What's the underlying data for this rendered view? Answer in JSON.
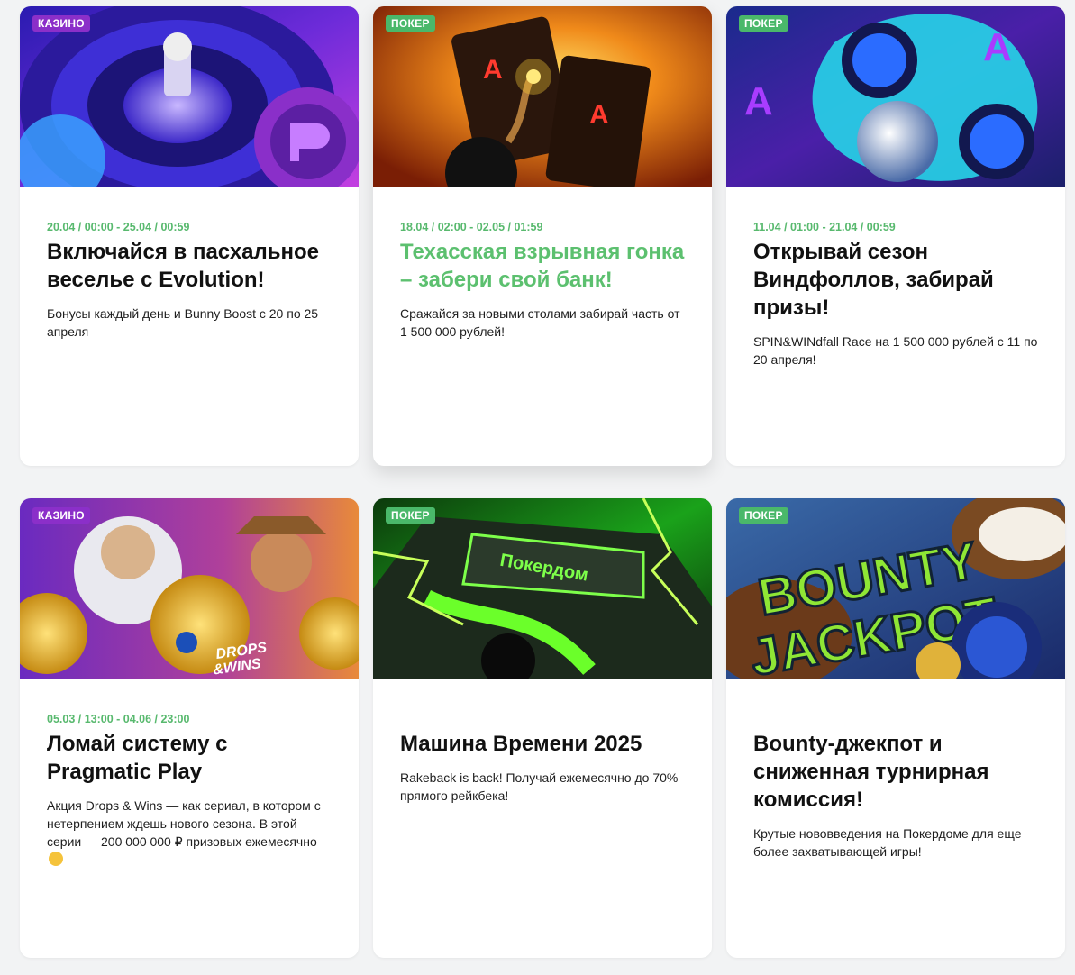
{
  "cards": [
    {
      "badge": "КАЗИНО",
      "date": "20.04 / 00:00 - 25.04 / 00:59",
      "title": "Включайся в пасхальное веселье с Evolution!",
      "description": "Бонусы каждый день и Bunny Boost с 20 по 25 апреля",
      "banner_icon": "roulette-wheel-icon"
    },
    {
      "badge": "ПОКЕР",
      "date": "18.04 / 02:00 - 02.05 / 01:59",
      "title": "Техасская взрывная гонка – забери свой банк!",
      "description": "Сражайся за новыми столами забирай часть от 1 500 000 рублей!",
      "banner_icon": "bomb-cards-icon"
    },
    {
      "badge": "ПОКЕР",
      "date": "11.04 / 01:00 - 21.04 / 00:59",
      "title": "Открывай сезон Виндфоллов, забирай призы!",
      "description": "SPIN&WINdfall Race на 1 500 000 рублей с 11 по 20 апреля!",
      "banner_icon": "fidget-spinner-icon"
    },
    {
      "badge": "КАЗИНО",
      "date": "05.03 / 13:00 - 04.06 / 23:00",
      "title": "Ломай систему с Pragmatic Play",
      "description": "Акция Drops & Wins — как сериал, в котором с нетерпением ждешь нового сезона. В этой серии — 200 000 000 ₽ призовых ежемесячно",
      "banner_icon": "drops-wins-icon",
      "banner_text": [
        "DROPS",
        "&WINS"
      ]
    },
    {
      "badge": "ПОКЕР",
      "date": "",
      "title": "Машина Времени 2025",
      "description": "Rakeback is back! Получай ежемесячно до 70% прямого рейкбека!",
      "banner_icon": "time-machine-car-icon",
      "banner_text": [
        "Покердом"
      ]
    },
    {
      "badge": "ПОКЕР",
      "date": "",
      "title": "Bounty-джекпот и сниженная турнирная комиссия!",
      "description": "Крутые нововведения на Покердоме для еще более захватывающей игры!",
      "banner_icon": "bounty-jackpot-icon",
      "banner_text": [
        "BOUNTY",
        "JACKPOT"
      ]
    }
  ],
  "colors": {
    "casino_badge": "#8b2fc9",
    "poker_badge": "#4ab86a",
    "date_green": "#58b96e",
    "hover_title": "#5cc06f"
  }
}
